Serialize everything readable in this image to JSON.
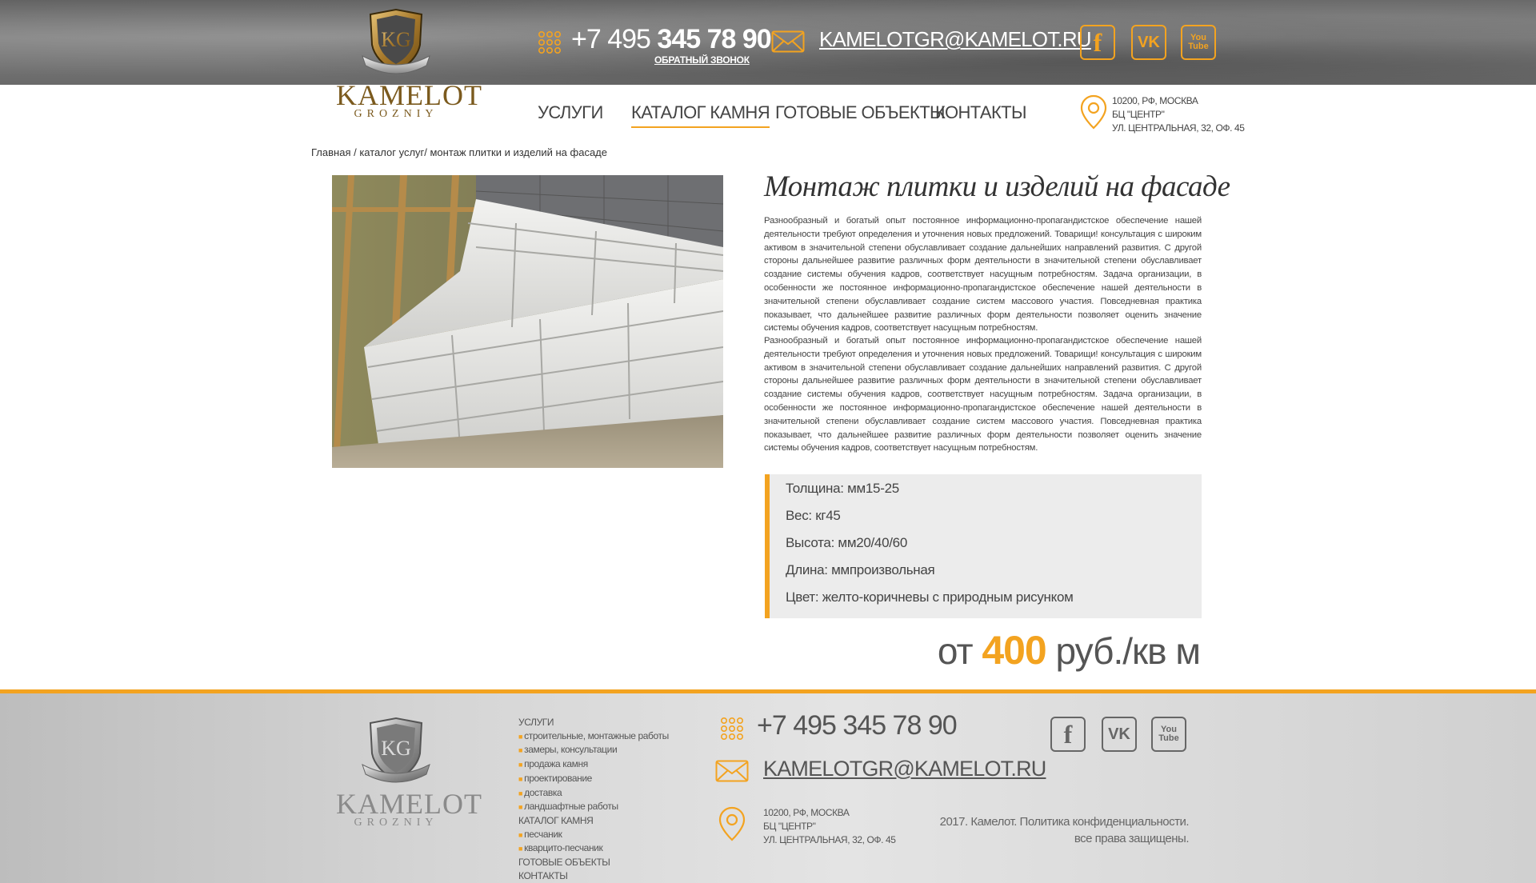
{
  "header": {
    "logo": {
      "name": "KAMELOT",
      "sub": "GROZNIY",
      "monogram": "KG"
    },
    "phone": {
      "prefix": "+7 495 ",
      "number": "345 78 90"
    },
    "callback_label": "ОБРАТНЫЙ ЗВОНОК",
    "email": "KAMELOTGR@KAMELOT.RU",
    "social": {
      "fb": "f",
      "vk": "VK",
      "yt_line1": "You",
      "yt_line2": "Tube"
    }
  },
  "nav": {
    "items": [
      {
        "label": "УСЛУГИ"
      },
      {
        "label": "КАТАЛОГ КАМНЯ"
      },
      {
        "label": "ГОТОВЫЕ ОБЪЕКТЫ"
      },
      {
        "label": "КОНТАКТЫ"
      }
    ]
  },
  "address": {
    "line1": "10200, РФ, МОСКВА",
    "line2": "БЦ \"ЦЕНТР\"",
    "line3": "УЛ. ЦЕНТРАЛЬНАЯ, 32, ОФ. 45"
  },
  "breadcrumb": "Главная / каталог услуг/ монтаж плитки и изделий на фасаде",
  "product": {
    "title": "Монтаж плитки и изделий на фасаде",
    "paragraph1": "Разнообразный и богатый опыт постоянное информационно-пропагандистское обеспечение нашей деятельности требуют определения и уточнения новых предложений. Товарищи! консультация с широким активом в значительной степени обуславливает создание дальнейших направлений развития. С другой стороны дальнейшее развитие различных форм деятельности в значительной степени обуславливает создание системы обучения кадров, соответствует насущным потребностям. Задача организации, в особенности же постоянное информационно-пропагандистское обеспечение нашей деятельности в значительной степени обуславливает создание систем массового участия. Повседневная практика показывает, что дальнейшее развитие различных форм деятельности позволяет оценить значение системы обучения кадров, соответствует насущным потребностям.",
    "paragraph2": "Разнообразный и богатый опыт постоянное информационно-пропагандистское обеспечение нашей деятельности требуют определения и уточнения новых предложений. Товарищи! консультация с широким активом в значительной степени обуславливает создание дальнейших направлений развития. С другой стороны дальнейшее развитие различных форм деятельности в значительной степени обуславливает создание системы обучения кадров, соответствует насущным потребностям. Задача организации, в особенности же постоянное информационно-пропагандистское обеспечение нашей деятельности в значительной степени обуславливает создание систем массового участия. Повседневная практика показывает, что дальнейшее развитие различных форм деятельности позволяет оценить значение системы обучения кадров, соответствует насущным потребностям.",
    "specs": [
      "Толщина: мм15-25",
      "Вес: кг45",
      "Высота: мм20/40/60",
      "Длина: ммпроизвольная",
      "Цвет: желто-коричневы с природным рисунком"
    ],
    "price": {
      "prefix": "от ",
      "value": "400",
      "suffix": " руб./кв м"
    }
  },
  "footer": {
    "links": [
      {
        "label": "УСЛУГИ",
        "sub": false
      },
      {
        "label": "строительные, монтажные работы",
        "sub": true
      },
      {
        "label": "замеры, консультации",
        "sub": true
      },
      {
        "label": "продажа камня",
        "sub": true
      },
      {
        "label": "проектирование",
        "sub": true
      },
      {
        "label": "доставка",
        "sub": true
      },
      {
        "label": "ландшафтные работы",
        "sub": true
      },
      {
        "label": "КАТАЛОГ КАМНЯ",
        "sub": false
      },
      {
        "label": "песчаник",
        "sub": true
      },
      {
        "label": "кварцито-песчаник",
        "sub": true
      },
      {
        "label": "ГОТОВЫЕ ОБЪЕКТЫ",
        "sub": false
      },
      {
        "label": "КОНТАКТЫ",
        "sub": false
      }
    ],
    "phone": "+7 495 345 78 90",
    "email": "KAMELOTGR@KAMELOT.RU",
    "copyright_line1": "2017. Камелот. Политика конфиденциальности.",
    "copyright_line2": "все права защищены."
  },
  "colors": {
    "accent": "#f3a320",
    "header_bg": "#6e6e6e",
    "footer_bg": "#d4d4d4",
    "spec_bg": "#ececec"
  },
  "icons": [
    "dialpad-icon",
    "envelope-icon",
    "map-pin-icon",
    "facebook-icon",
    "vk-icon",
    "youtube-icon",
    "shield-logo-icon"
  ]
}
